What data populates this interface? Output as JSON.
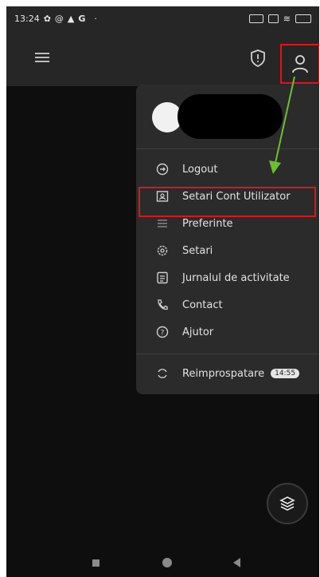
{
  "status_bar": {
    "time": "13:24",
    "letter": "G",
    "dot": "·"
  },
  "app_bar": {
    "menu_icon": "hamburger-icon",
    "alert_icon": "shield-alert-icon",
    "user_icon": "user-icon"
  },
  "menu": {
    "items": [
      {
        "label": "Logout",
        "icon": "logout-icon"
      },
      {
        "label": "Setari Cont Utilizator",
        "icon": "account-card-icon"
      },
      {
        "label": "Preferinte",
        "icon": "list-icon"
      },
      {
        "label": "Setari",
        "icon": "gear-icon"
      },
      {
        "label": "Jurnalul de activitate",
        "icon": "journal-icon"
      },
      {
        "label": "Contact",
        "icon": "phone-icon"
      },
      {
        "label": "Ajutor",
        "icon": "help-icon"
      }
    ],
    "refresh": {
      "label": "Reimprospatare",
      "time": "14:55",
      "icon": "refresh-icon"
    }
  },
  "colors": {
    "highlight": "#e0141b",
    "arrow": "#6cc02c"
  }
}
